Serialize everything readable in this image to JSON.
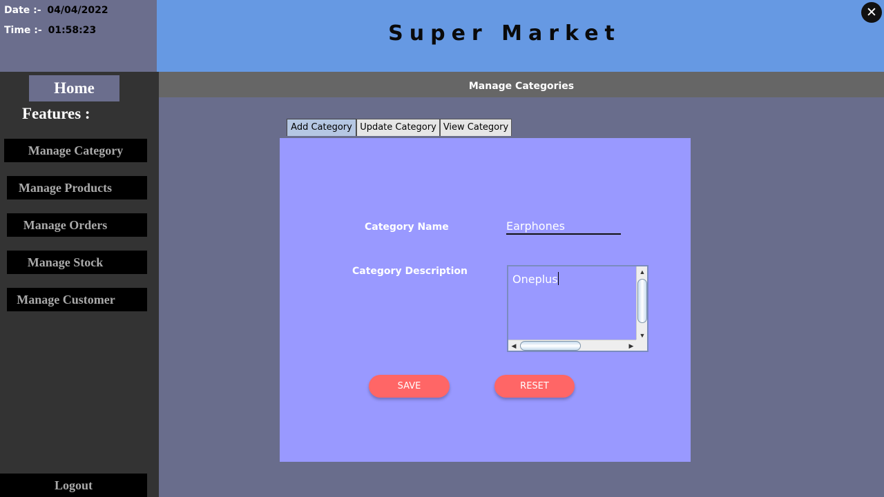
{
  "clock": {
    "date_label": "Date :-",
    "date_value": "04/04/2022",
    "time_label": "Time :-",
    "time_value": "01:58:23"
  },
  "header": {
    "title": "Super Market",
    "close_icon": "close-icon"
  },
  "sidebar": {
    "home": "Home",
    "features_label": "Features :",
    "items": [
      {
        "label": "Manage Category"
      },
      {
        "label": "Manage Products"
      },
      {
        "label": "Manage Orders"
      },
      {
        "label": "Manage Stock"
      },
      {
        "label": "Manage Customer"
      }
    ],
    "logout": "Logout"
  },
  "section": {
    "title": "Manage Categories"
  },
  "tabs": [
    {
      "label": "Add Category",
      "active": true
    },
    {
      "label": "Update Category",
      "active": false
    },
    {
      "label": "View Category",
      "active": false
    }
  ],
  "form": {
    "name_label": "Category Name",
    "name_value": "Earphones",
    "description_label": "Category Description",
    "description_value": "Oneplus",
    "save_label": "SAVE",
    "reset_label": "RESET"
  },
  "colors": {
    "header_bg": "#6699e3",
    "sidebar_bg": "#333333",
    "panel_bg": "#9999ff",
    "button_bg": "#ff6666",
    "content_bg": "#696d8c"
  }
}
